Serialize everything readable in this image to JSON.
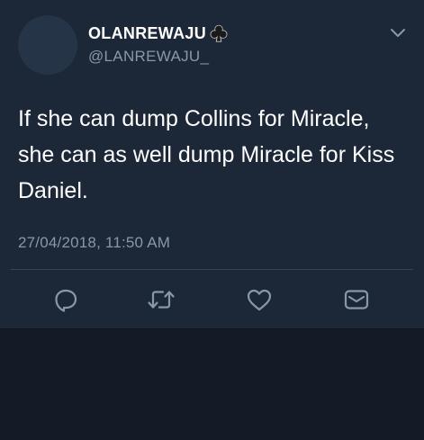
{
  "user": {
    "display_name": "OLANREWAJU",
    "handle": "@LANREWAJU_",
    "badge_icon": "club-suit-icon"
  },
  "tweet": {
    "text": "If she can dump Collins for Miracle, she can as well dump Miracle for Kiss Daniel.",
    "timestamp": "27/04/2018, 11:50 AM"
  },
  "actions": [
    {
      "name": "reply",
      "icon": "reply-icon"
    },
    {
      "name": "retweet",
      "icon": "retweet-icon"
    },
    {
      "name": "like",
      "icon": "heart-icon"
    },
    {
      "name": "message",
      "icon": "envelope-icon"
    }
  ],
  "colors": {
    "card_bg": "#1c2737",
    "page_bg": "#141b26",
    "text_primary": "#ffffff",
    "text_secondary": "#8899a6",
    "divider": "#38444d"
  }
}
